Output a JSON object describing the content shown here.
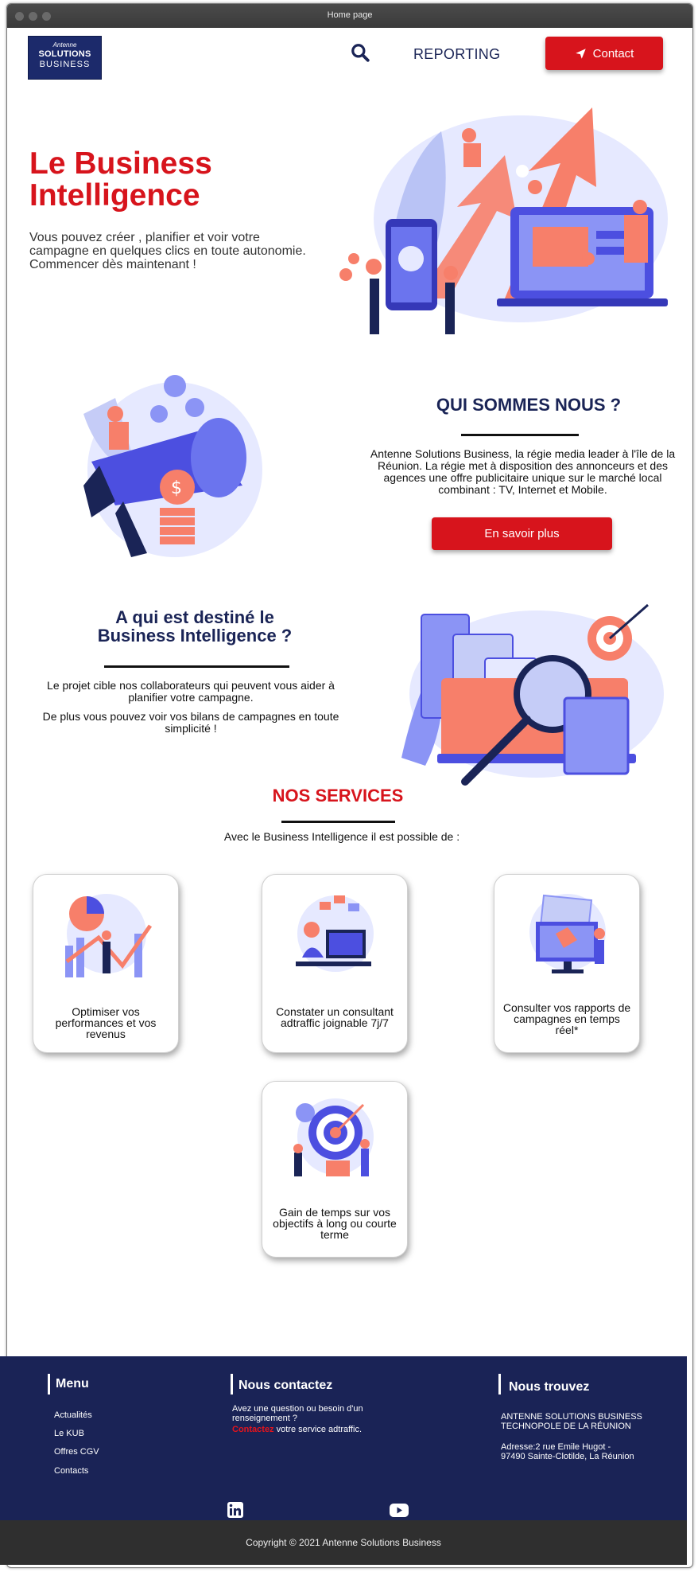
{
  "window": {
    "title": "Home page"
  },
  "nav": {
    "logo_line1": "Antenne",
    "logo_line2": "SOLUTIONS",
    "logo_line3": "BUSINESS",
    "reporting_label": "REPORTING",
    "contact_label": "Contact"
  },
  "hero": {
    "title_line1": "Le Business",
    "title_line2": "Intelligence",
    "text": "Vous pouvez créer , planifier et voir votre campagne en quelques clics en toute autonomie. Commencer dès maintenant !"
  },
  "about": {
    "title": "QUI SOMMES NOUS ?",
    "text": "Antenne Solutions Business, la régie media leader à l'île de la Réunion. La régie met à disposition des annonceurs et des agences une offre publicitaire unique sur le marché local combinant : TV, Internet et Mobile.",
    "button_label": "En savoir plus"
  },
  "audience": {
    "title_line1": "A qui est destiné le",
    "title_line2": "Business Intelligence ?",
    "para1": "Le projet cible nos collaborateurs qui peuvent vous aider à planifier votre campagne.",
    "para2": "De plus vous pouvez voir vos bilans de campagnes en toute simplicité !"
  },
  "services": {
    "title": "NOS SERVICES",
    "subtitle": "Avec le Business Intelligence il est possible de :",
    "cards": [
      {
        "text": "Optimiser vos performances et vos revenus"
      },
      {
        "text": "Constater un consultant adtraffic joignable 7j/7"
      },
      {
        "text": "Consulter vos rapports de campagnes en temps réel*"
      },
      {
        "text": "Gain de temps sur vos objectifs à long ou courte terme"
      }
    ]
  },
  "footer": {
    "menu_title": "Menu",
    "menu_items": [
      "Actualités",
      "Le KUB",
      "Offres CGV",
      "Contacts"
    ],
    "contact_title": "Nous contactez",
    "contact_text": "Avez une question ou besoin d'un renseignement ?",
    "contact_link": "Contactez",
    "contact_suffix": " votre service adtraffic.",
    "find_title": "Nous trouvez",
    "company": "ANTENNE SOLUTIONS BUSINESS TECHNOPOLE DE LA RÉUNION",
    "address": "Adresse:2 rue Emile Hugot - 97490 Sainte-Clotilde, La Réunion",
    "copyright": "Copyright © 2021 Antenne Solutions Business"
  },
  "colors": {
    "brand_red": "#d7141c",
    "navy": "#1a2356"
  },
  "icons": [
    "search-icon",
    "send-icon",
    "linkedin-icon",
    "youtube-icon"
  ]
}
